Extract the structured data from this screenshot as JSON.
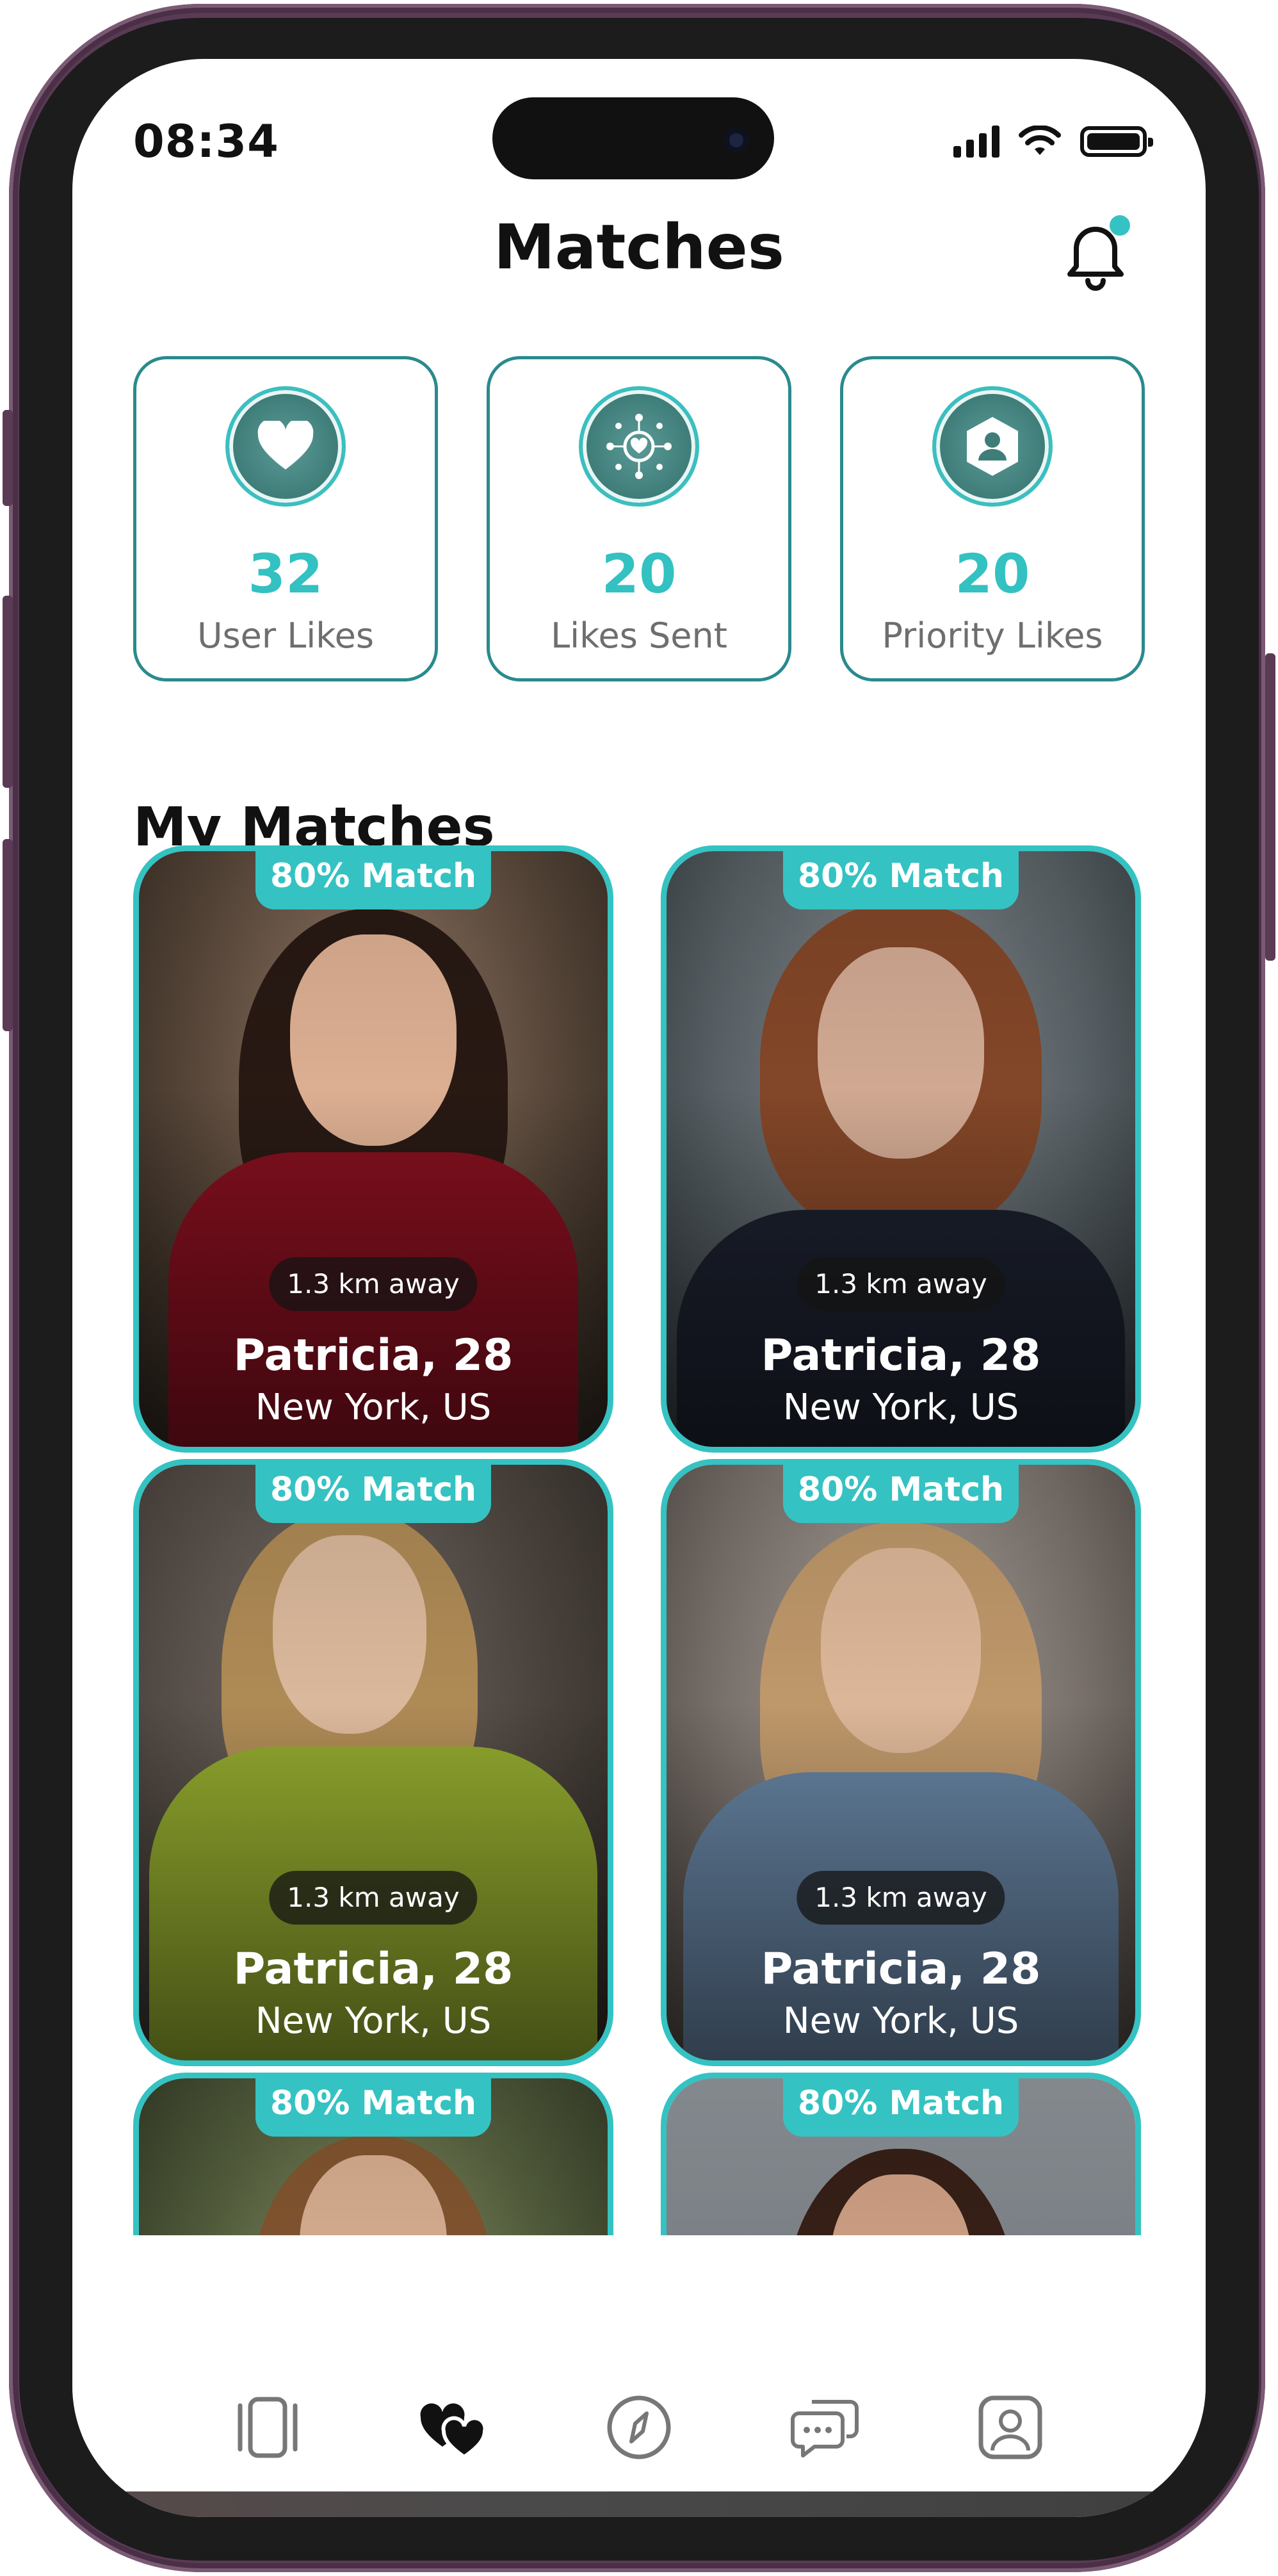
{
  "status_bar": {
    "time": "08:34"
  },
  "header": {
    "title": "Matches",
    "notification_icon": "bell-icon",
    "notification_dot_color": "#35c2c2"
  },
  "stats": [
    {
      "value": "32",
      "label": "User Likes",
      "icon": "heart-icon"
    },
    {
      "value": "20",
      "label": "Likes Sent",
      "icon": "network-heart-icon"
    },
    {
      "value": "20",
      "label": "Priority Likes",
      "icon": "badge-user-icon"
    }
  ],
  "section": {
    "title": "My Matches"
  },
  "matches": [
    {
      "badge": "80% Match",
      "distance": "1.3 km away",
      "name": "Patricia, 28",
      "location": "New York, US"
    },
    {
      "badge": "80% Match",
      "distance": "1.3 km away",
      "name": "Patricia, 28",
      "location": "New York, US"
    },
    {
      "badge": "80% Match",
      "distance": "1.3 km away",
      "name": "Patricia, 28",
      "location": "New York, US"
    },
    {
      "badge": "80% Match",
      "distance": "1.3 km away",
      "name": "Patricia, 28",
      "location": "New York, US"
    },
    {
      "badge": "80% Match"
    },
    {
      "badge": "80% Match"
    }
  ],
  "nav": [
    {
      "icon": "cards-icon",
      "active": false
    },
    {
      "icon": "hearts-icon",
      "active": true
    },
    {
      "icon": "compass-icon",
      "active": false
    },
    {
      "icon": "chat-icon",
      "active": false
    },
    {
      "icon": "profile-icon",
      "active": false
    }
  ],
  "colors": {
    "accent": "#35c2c2",
    "card_border": "#2a8a8c",
    "frame": "#5a3a55"
  }
}
